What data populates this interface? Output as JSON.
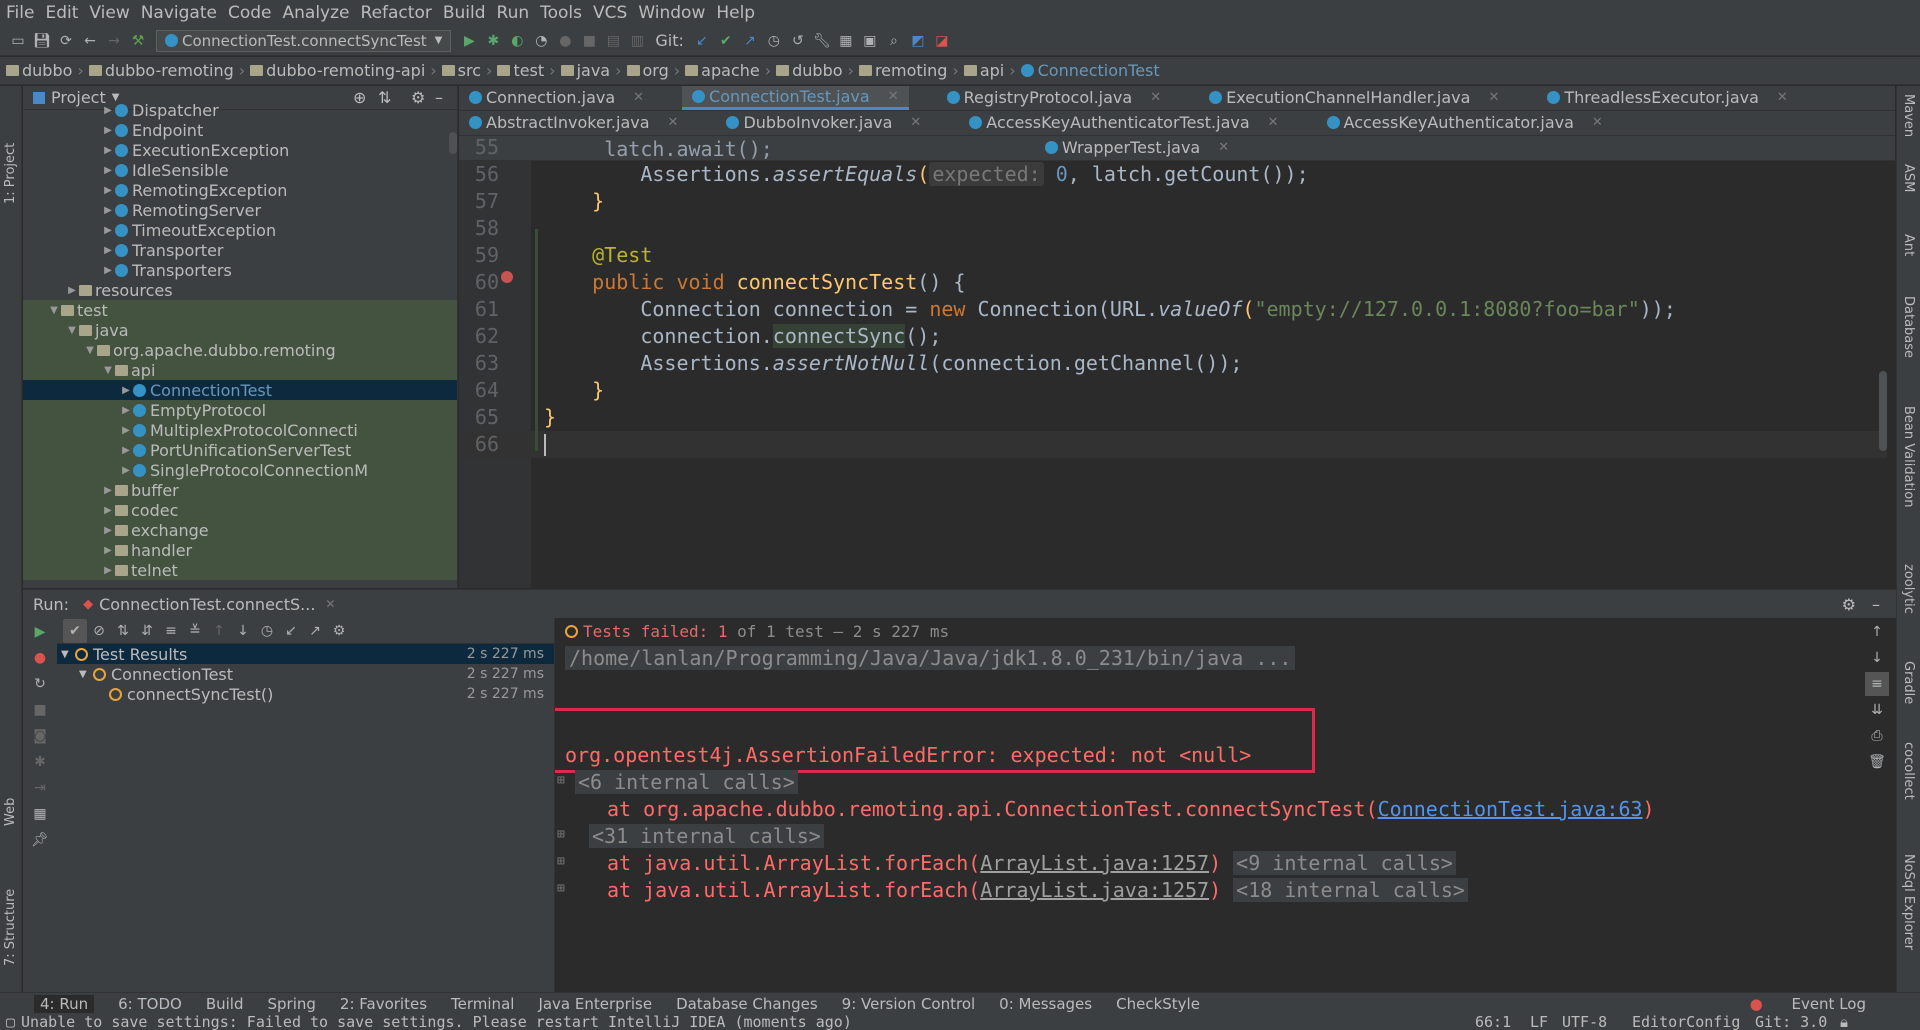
{
  "menu": [
    "File",
    "Edit",
    "View",
    "Navigate",
    "Code",
    "Analyze",
    "Refactor",
    "Build",
    "Run",
    "Tools",
    "VCS",
    "Window",
    "Help"
  ],
  "toolbar": {
    "run_config": "ConnectionTest.connectSyncTest",
    "git_label": "Git:"
  },
  "breadcrumbs": [
    "dubbo",
    "dubbo-remoting",
    "dubbo-remoting-api",
    "src",
    "test",
    "java",
    "org",
    "apache",
    "dubbo",
    "remoting",
    "api",
    "ConnectionTest"
  ],
  "project": {
    "title": "Project",
    "tree": [
      {
        "label": "Dispatcher",
        "type": "class"
      },
      {
        "label": "Endpoint",
        "type": "class"
      },
      {
        "label": "ExecutionException",
        "type": "class"
      },
      {
        "label": "IdleSensible",
        "type": "class"
      },
      {
        "label": "RemotingException",
        "type": "class"
      },
      {
        "label": "RemotingServer",
        "type": "class"
      },
      {
        "label": "TimeoutException",
        "type": "class"
      },
      {
        "label": "Transporter",
        "type": "class"
      },
      {
        "label": "Transporters",
        "type": "class"
      },
      {
        "label": "resources",
        "type": "folder"
      },
      {
        "label": "test",
        "type": "folder"
      },
      {
        "label": "java",
        "type": "folder"
      },
      {
        "label": "org.apache.dubbo.remoting",
        "type": "folder"
      },
      {
        "label": "api",
        "type": "folder"
      },
      {
        "label": "ConnectionTest",
        "type": "class"
      },
      {
        "label": "EmptyProtocol",
        "type": "class"
      },
      {
        "label": "MultiplexProtocolConnecti",
        "type": "class"
      },
      {
        "label": "PortUnificationServerTest",
        "type": "class"
      },
      {
        "label": "SingleProtocolConnectionM",
        "type": "class"
      },
      {
        "label": "buffer",
        "type": "folder"
      },
      {
        "label": "codec",
        "type": "folder"
      },
      {
        "label": "exchange",
        "type": "folder"
      },
      {
        "label": "handler",
        "type": "folder"
      },
      {
        "label": "telnet",
        "type": "folder"
      }
    ]
  },
  "editor_tabs": {
    "row1": [
      "Connection.java",
      "ConnectionTest.java",
      "RegistryProtocol.java",
      "ExecutionChannelHandler.java",
      "ThreadlessExecutor.java"
    ],
    "row2": [
      "AbstractInvoker.java",
      "DubboInvoker.java",
      "AccessKeyAuthenticatorTest.java",
      "AccessKeyAuthenticator.java"
    ],
    "row3": [
      "WrapperTest.java"
    ],
    "active": "ConnectionTest.java"
  },
  "code": {
    "line_numbers": [
      "55",
      "56",
      "57",
      "58",
      "59",
      "60",
      "61",
      "62",
      "63",
      "64",
      "65",
      "66"
    ],
    "l55": "latch.await();",
    "l56_a": "Assertions.",
    "l56_b": "assertEquals",
    "l56_hint": "expected:",
    "l56_c": "0",
    "l56_d": ", latch.getCount());",
    "l57": "}",
    "l59": "@Test",
    "l60_kw": "public void ",
    "l60_fn": "connectSyncTest",
    "l60_rest": "() {",
    "l61_a": "Connection connection = ",
    "l61_kw": "new ",
    "l61_b": "Connection(URL.",
    "l61_c": "valueOf",
    "l61_str": "\"empty://127.0.0.1:8080?foo=bar\"",
    "l61_d": "));",
    "l62_a": "connection.",
    "l62_b": "connectSync",
    "l62_c": "();",
    "l63_a": "Assertions.",
    "l63_b": "assertNotNull",
    "l63_c": "(connection.getChannel());",
    "l64": "}",
    "l65": "}"
  },
  "run": {
    "label": "Run:",
    "tab": "ConnectionTest.connectS...",
    "status_failed": "Tests failed:",
    "status_count": "1",
    "status_rest": "of 1 test – 2 s 227 ms",
    "results": [
      {
        "label": "Test Results",
        "time": "2 s 227 ms"
      },
      {
        "label": "ConnectionTest",
        "time": "2 s 227 ms"
      },
      {
        "label": "connectSyncTest()",
        "time": "2 s 227 ms"
      }
    ],
    "console": {
      "cmd": "/home/lanlan/Programming/Java/Java/jdk1.8.0_231/bin/java ...",
      "error": "org.opentest4j.AssertionFailedError: expected: not <null>",
      "internal6": "<6 internal calls>",
      "at1_pre": "at org.apache.dubbo.remoting.api.ConnectionTest.connectSyncTest(",
      "at1_link": "ConnectionTest.java:63",
      "at1_post": ")",
      "internal31": "<31 internal calls>",
      "at2_pre": "at java.util.ArrayList.forEach(",
      "at2_link": "ArrayList.java:1257",
      "at2_post": ")",
      "internal9": "<9 internal calls>",
      "at3_pre": "at java.util.ArrayList.forEach(",
      "at3_link": "ArrayList.java:1257",
      "at3_post": ")",
      "internal18": "<18 internal calls>"
    }
  },
  "left_tools": [
    "1: Project",
    "Web",
    "7: Structure"
  ],
  "right_tools": [
    "Maven",
    "ASM",
    "Ant",
    "Database",
    "Bean Validation",
    "zoolytic",
    "Gradle",
    "cocollect",
    "NoSql Explorer"
  ],
  "bottom_tools": [
    "4: Run",
    "6: TODO",
    "Build",
    "Spring",
    "2: Favorites",
    "Terminal",
    "Java Enterprise",
    "Database Changes",
    "9: Version Control",
    "0: Messages",
    "CheckStyle"
  ],
  "event_log": "Event Log",
  "status": {
    "message": "Unable to save settings: Failed to save settings. Please restart IntelliJ IDEA (moments ago)",
    "position": "66:1",
    "line_sep": "LF",
    "encoding": "UTF-8",
    "editor_config": "EditorConfig",
    "git": "Git: 3.0"
  }
}
